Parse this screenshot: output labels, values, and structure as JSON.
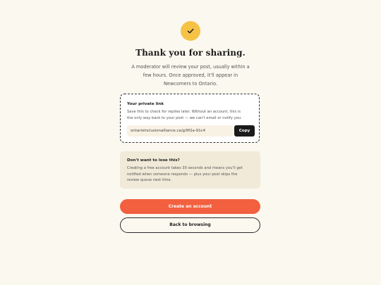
{
  "icons": {
    "success": "check-icon"
  },
  "colors": {
    "accent_yellow": "#f6c246",
    "primary_button": "#f2603f",
    "background": "#fbf8ef",
    "info_card": "#f1ead9"
  },
  "header": {
    "title": "Thank you for sharing.",
    "subtitle_line1": "A moderator will review your post, usually within a",
    "subtitle_line2": "few hours. Once approved, it'll appear in",
    "subtitle_line3": "Newcomers to Ontario."
  },
  "private_link": {
    "heading": "Your private link",
    "desc_line1": "Save this to check for replies later. Without an account, this is",
    "desc_line2": "the only way back to your post — we can't email or notify you.",
    "url": "ontarioinclusionalliance.ca/g/9f2a-91c4",
    "copy_label": "Copy"
  },
  "account_prompt": {
    "heading": "Don't want to lose this?",
    "desc_line1": "Creating a free account takes 30 seconds and means you'll get",
    "desc_line2": "notified when someone responds — plus your post skips the",
    "desc_line3": "review queue next time."
  },
  "actions": {
    "create_account": "Create an account",
    "back_to_browsing": "Back to browsing"
  }
}
